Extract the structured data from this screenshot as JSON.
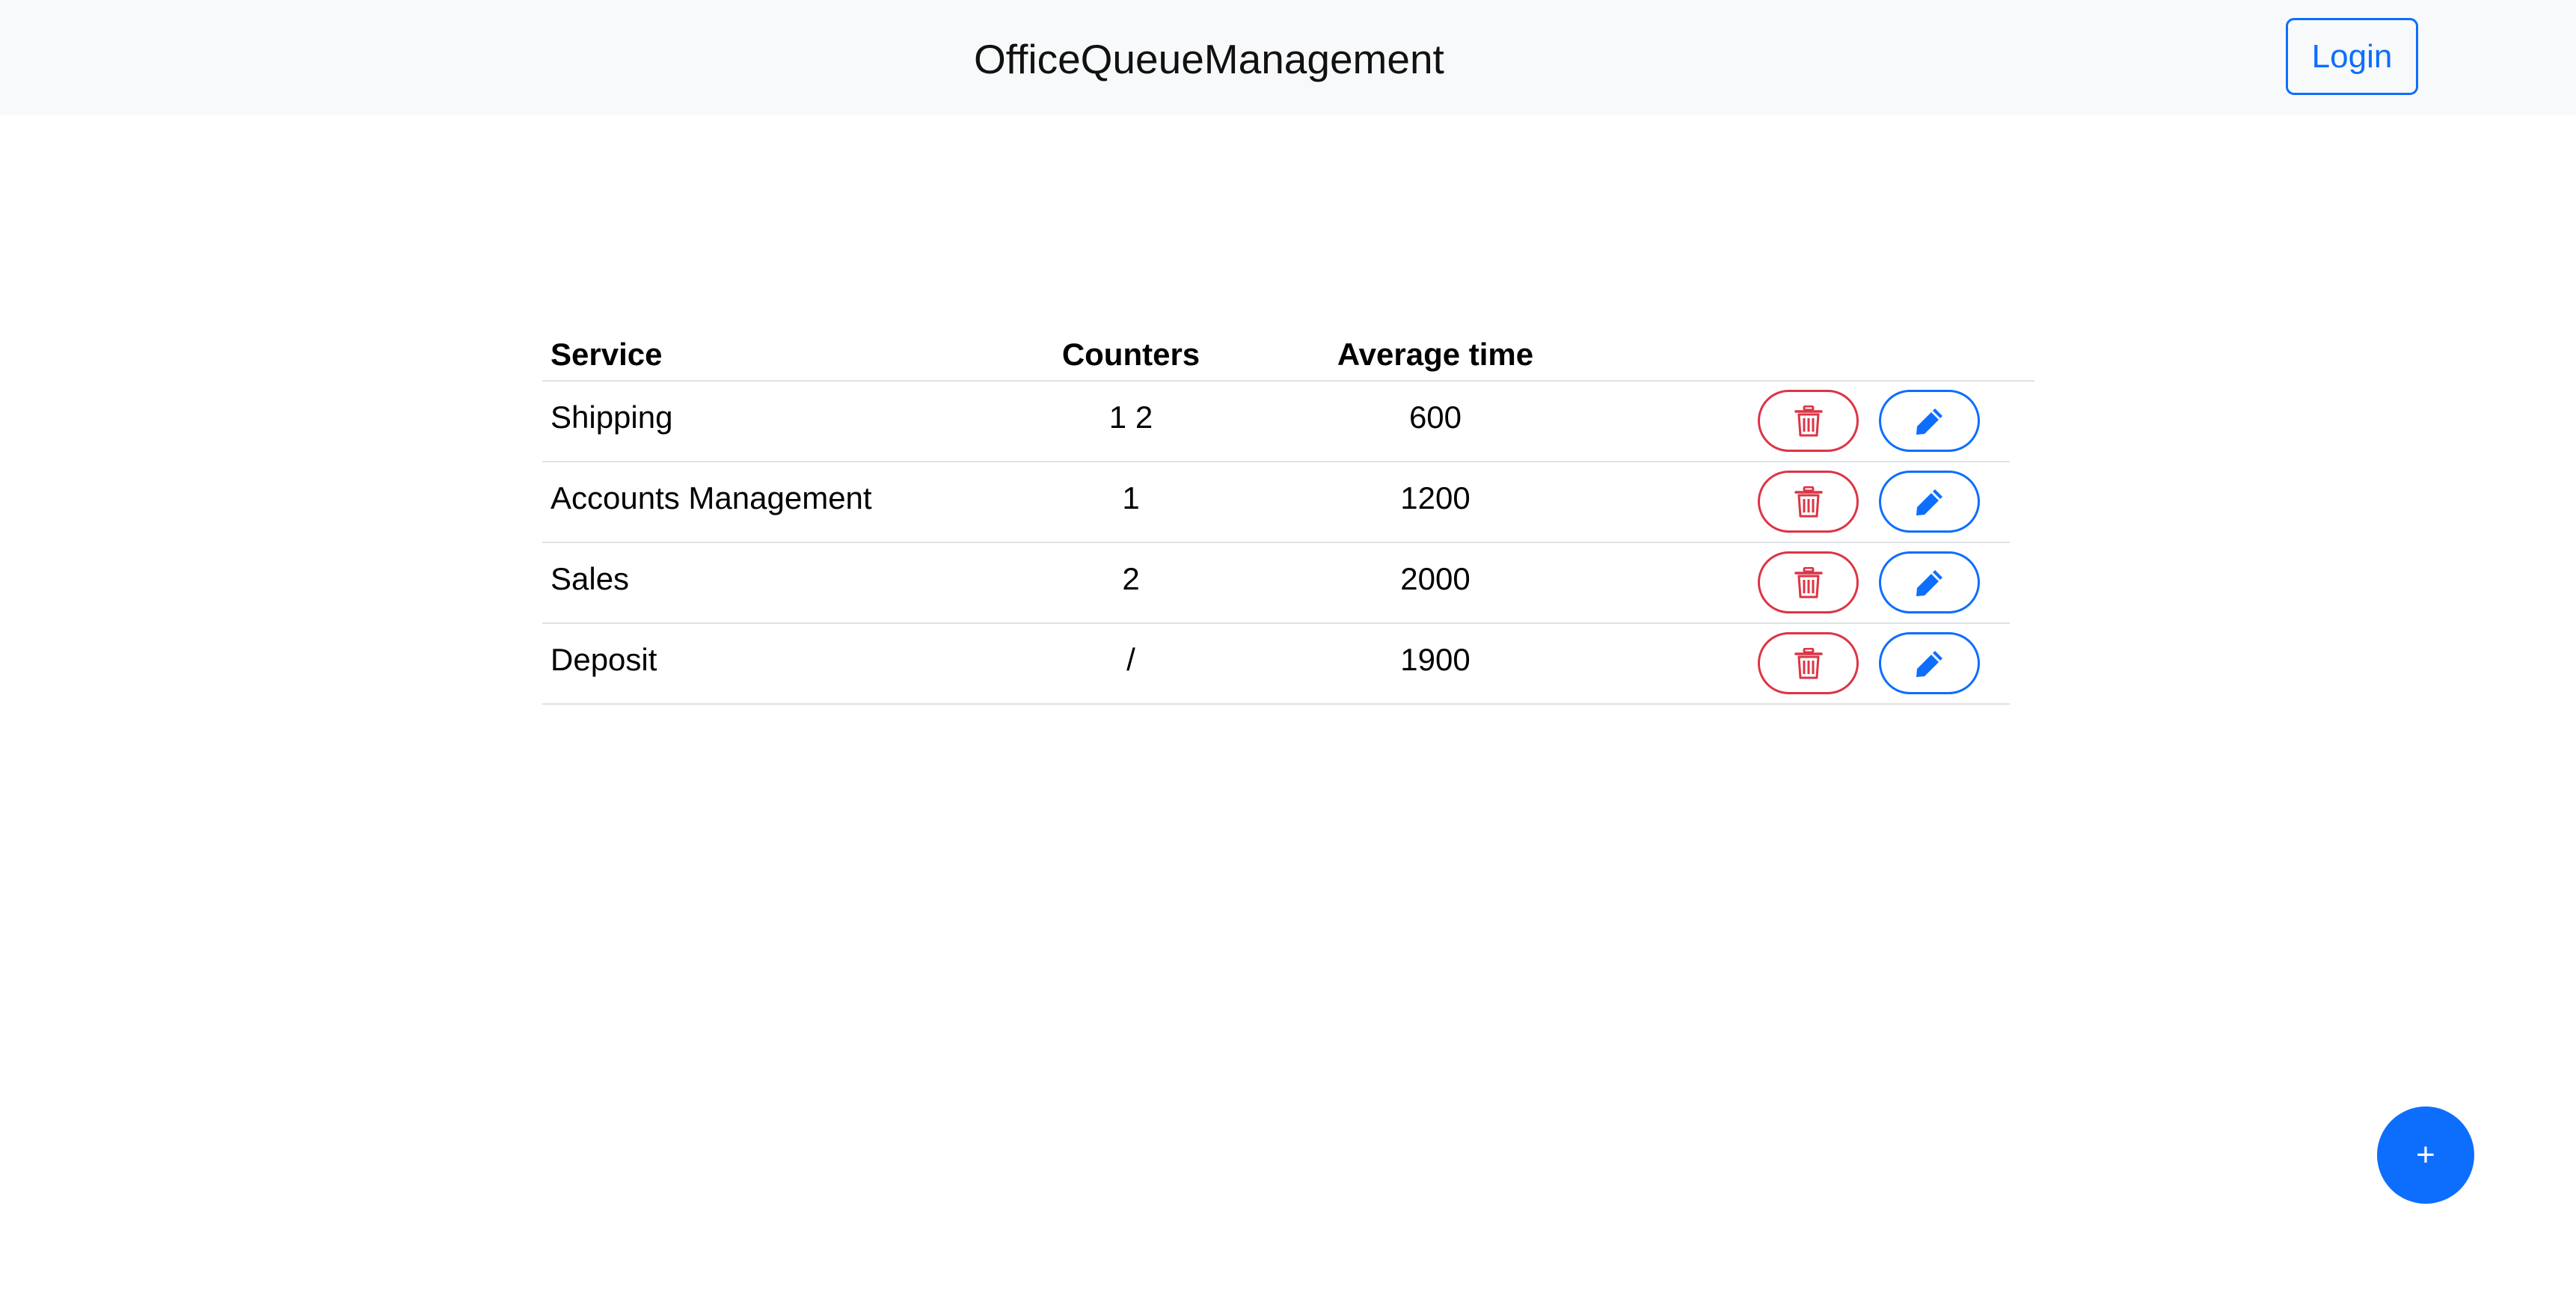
{
  "navbar": {
    "brand": "OfficeQueueManagement",
    "login_label": "Login"
  },
  "table": {
    "headers": {
      "service": "Service",
      "counters": "Counters",
      "average_time": "Average time"
    },
    "rows": [
      {
        "service": "Shipping",
        "counters": "1 2",
        "average_time": "600"
      },
      {
        "service": "Accounts Management",
        "counters": "1",
        "average_time": "1200"
      },
      {
        "service": "Sales",
        "counters": "2",
        "average_time": "2000"
      },
      {
        "service": "Deposit",
        "counters": "/",
        "average_time": "1900"
      }
    ],
    "row_actions": [
      "trash-icon",
      "pencil-icon"
    ]
  },
  "fab": {
    "label": "+"
  },
  "colors": {
    "primary": "#0d6efd",
    "danger": "#dc3545",
    "navbar_bg": "#f8f9fa"
  }
}
